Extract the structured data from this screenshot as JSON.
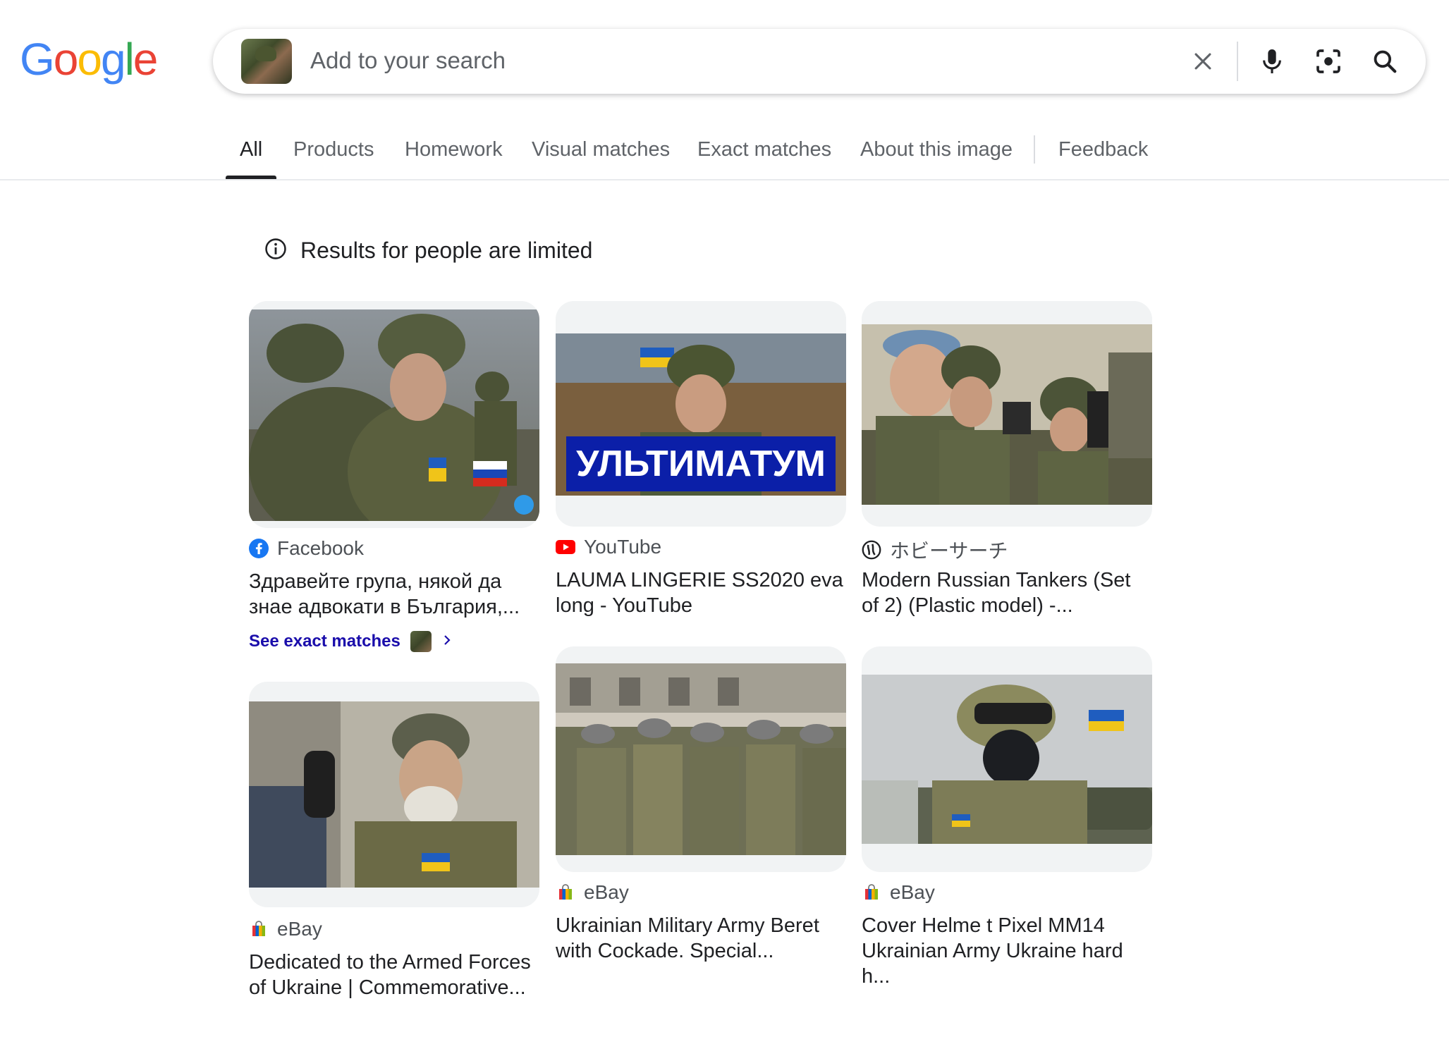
{
  "header": {
    "logo_letters": [
      {
        "ch": "G",
        "color": "#4285F4"
      },
      {
        "ch": "o",
        "color": "#EA4335"
      },
      {
        "ch": "o",
        "color": "#FBBC05"
      },
      {
        "ch": "g",
        "color": "#4285F4"
      },
      {
        "ch": "l",
        "color": "#34A853"
      },
      {
        "ch": "e",
        "color": "#EA4335"
      }
    ],
    "search": {
      "placeholder": "Add to your search",
      "icons": [
        "clear-icon",
        "mic-icon",
        "lens-icon",
        "search-icon"
      ]
    }
  },
  "tabs": [
    {
      "label": "All",
      "active": true
    },
    {
      "label": "Products"
    },
    {
      "label": "Homework"
    },
    {
      "label": "Visual matches"
    },
    {
      "label": "Exact matches"
    },
    {
      "label": "About this image"
    },
    {
      "label": "Feedback"
    }
  ],
  "notice": {
    "text": "Results for people are limited",
    "icon": "info-icon"
  },
  "results": [
    {
      "source": "Facebook",
      "source_icon": "facebook-icon",
      "title": "Здравейте група, някой да знае адвокати в България,..."
    },
    {
      "source": "YouTube",
      "source_icon": "youtube-icon",
      "title": "LAUMA LINGERIE SS2020 eva long - YouTube",
      "image_text": "УЛЬТИМАТУМ"
    },
    {
      "source": "ホビーサーチ",
      "source_icon": "hobbysearch-icon",
      "title": "Modern Russian Tankers (Set of 2) (Plastic model) -..."
    },
    {
      "source": "eBay",
      "source_icon": "ebay-icon",
      "title": "Dedicated to the Armed Forces of Ukraine | Commemorative..."
    },
    {
      "source": "eBay",
      "source_icon": "ebay-icon",
      "title": "Ukrainian Military Army Beret with Cockade. Special..."
    },
    {
      "source": "eBay",
      "source_icon": "ebay-icon",
      "title": "Cover Helme t Pixel MM14 Ukrainian Army Ukraine hard h..."
    }
  ],
  "see_exact_matches": {
    "label": "See exact matches",
    "icon": "chevron-right-icon"
  },
  "colors": {
    "link": "#1a0dab",
    "text": "#202124",
    "muted": "#5f6368",
    "divider": "#dadce0"
  }
}
